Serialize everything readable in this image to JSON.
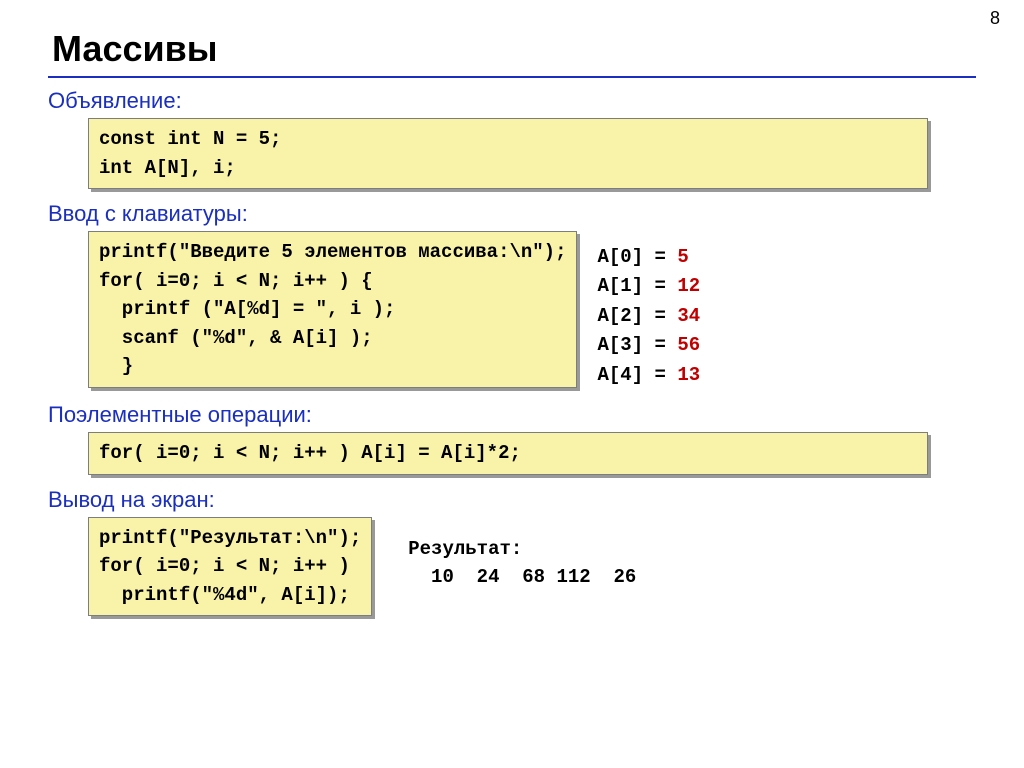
{
  "page_number": "8",
  "title": "Массивы",
  "sections": {
    "declaration": {
      "label": "Объявление:",
      "code": "const int N = 5;\nint A[N], i;"
    },
    "input": {
      "label": "Ввод с клавиатуры:",
      "code": "printf(\"Введите 5 элементов массива:\\n\");\nfor( i=0; i < N; i++ ) {\n  printf (\"A[%d] = \", i );\n  scanf (\"%d\", & A[i] );\n  }",
      "sample": [
        {
          "idx": "A[0] =",
          "val": "5"
        },
        {
          "idx": "A[1] =",
          "val": "12"
        },
        {
          "idx": "A[2] =",
          "val": "34"
        },
        {
          "idx": "A[3] =",
          "val": "56"
        },
        {
          "idx": "A[4] =",
          "val": "13"
        }
      ]
    },
    "ops": {
      "label": "Поэлементные операции:",
      "code": "for( i=0; i < N; i++ ) A[i] = A[i]*2;"
    },
    "output": {
      "label": "Вывод на экран:",
      "code": "printf(\"Результат:\\n\");\nfor( i=0; i < N; i++ )\n  printf(\"%4d\", A[i]);",
      "result_label": "Результат:",
      "result_values": "  10  24  68 112  26"
    }
  }
}
